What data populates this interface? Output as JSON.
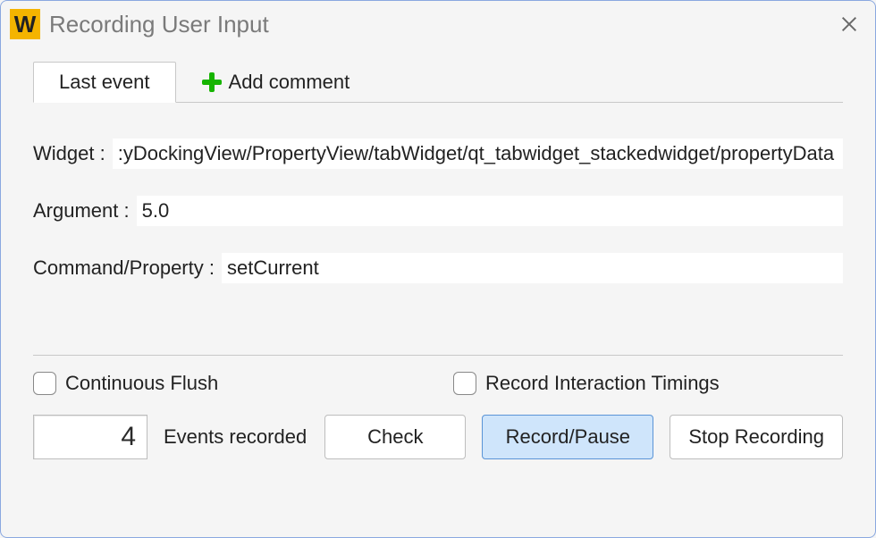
{
  "window": {
    "title": "Recording User Input",
    "icon_letter": "W"
  },
  "tabs": {
    "last_event": "Last event",
    "add_comment": "Add comment"
  },
  "fields": {
    "widget_label": "Widget :",
    "widget_value": ":yDockingView/PropertyView/tabWidget/qt_tabwidget_stackedwidget/propertyData",
    "argument_label": "Argument :",
    "argument_value": "5.0",
    "command_label": "Command/Property :",
    "command_value": "setCurrent"
  },
  "checks": {
    "continuous_flush": "Continuous Flush",
    "record_interaction_timings": "Record Interaction Timings"
  },
  "footer": {
    "counter": "4",
    "counter_label": "Events recorded",
    "check_btn": "Check",
    "record_pause_btn": "Record/Pause",
    "stop_btn": "Stop Recording"
  }
}
